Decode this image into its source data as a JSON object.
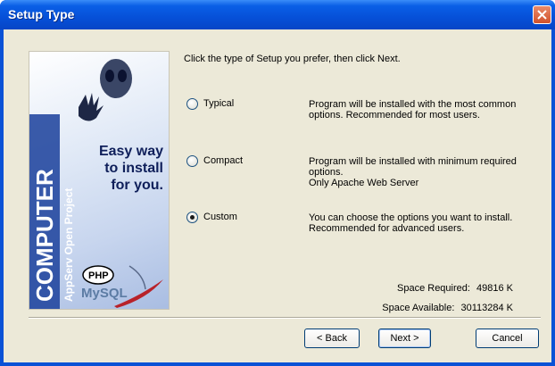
{
  "window": {
    "title": "Setup Type"
  },
  "banner": {
    "line1": "Easy way",
    "line2": "to install",
    "line3": "for you.",
    "brand": "COMPUTER",
    "sub": "AppServ Open Project",
    "php": "PHP",
    "mysql": "MySQL"
  },
  "main": {
    "intro": "Click the type of Setup you prefer, then click Next.",
    "options": [
      {
        "label": "Typical",
        "selected": false,
        "desc": [
          "Program will be installed with the most common",
          "options. Recommended for most users."
        ]
      },
      {
        "label": "Compact",
        "selected": false,
        "desc": [
          "Program will be installed with minimum required",
          "options.",
          "Only Apache Web Server"
        ]
      },
      {
        "label": "Custom",
        "selected": true,
        "desc": [
          "You can choose the options you want to install.",
          "Recommended for advanced users."
        ]
      }
    ],
    "space_required_label": "Space Required:",
    "space_required_value": "49816 K",
    "space_available_label": "Space Available:",
    "space_available_value": "30113284 K"
  },
  "buttons": {
    "back": "< Back",
    "next": "Next >",
    "cancel": "Cancel"
  }
}
